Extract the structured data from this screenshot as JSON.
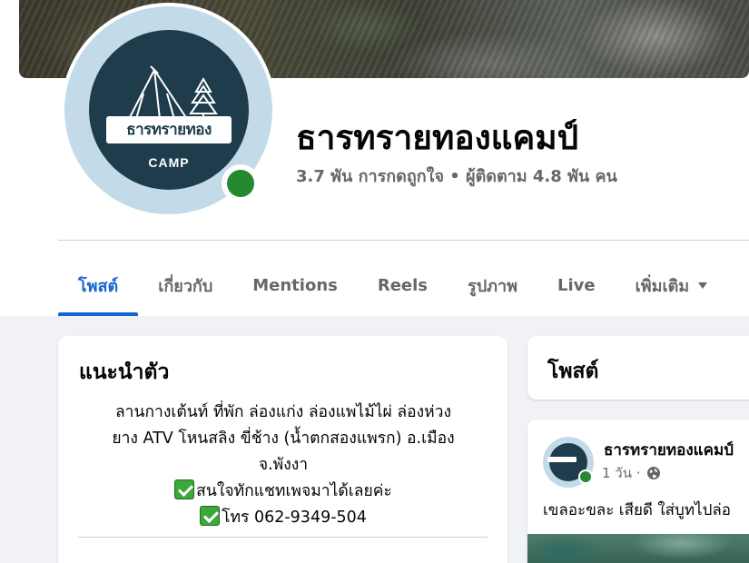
{
  "page": {
    "name": "ธารทรายทองแคมป์",
    "stats": "3.7 พัน การกดถูกใจ • ผู้ติดตาม 4.8 พัน คน",
    "logo_text": "ธารทรายทอง",
    "logo_subtext": "CAMP"
  },
  "tabs": [
    {
      "label": "โพสต์",
      "active": true
    },
    {
      "label": "เกี่ยวกับ",
      "active": false
    },
    {
      "label": "Mentions",
      "active": false
    },
    {
      "label": "Reels",
      "active": false
    },
    {
      "label": "รูปภาพ",
      "active": false
    },
    {
      "label": "Live",
      "active": false
    },
    {
      "label": "เพิ่มเติม",
      "active": false
    }
  ],
  "intro": {
    "title": "แนะนำตัว",
    "bio_line1": "ลานกางเต้นท์ ที่พัก ล่องแก่ง ล่องแพไม้ไผ่ ล่องห่วง",
    "bio_line2": "ยาง ATV โหนสลิง ขี่ช้าง (น้ำตกสองแพรก) อ.เมือง",
    "bio_line3": "จ.พังงา",
    "bio_line4": "สนใจทักแชทเพจมาได้เลยค่ะ",
    "bio_line5": "โทร 062-9349-504"
  },
  "posts": {
    "title": "โพสต์",
    "first_post": {
      "author": "ธารทรายทองแคมป์",
      "time": "1 วัน ·",
      "text": "เขลอะขละ เสียดี   ใส่บูทไปล่อ"
    }
  },
  "colors": {
    "accent": "#1b64d0",
    "online": "#24892f",
    "logo_bg": "#1e3c4b",
    "avatar_bg": "#c3dbe8"
  },
  "icons": [
    "globe-icon",
    "dropdown-caret-icon",
    "check-mark-icon",
    "tent-icon",
    "pine-tree-icon"
  ]
}
